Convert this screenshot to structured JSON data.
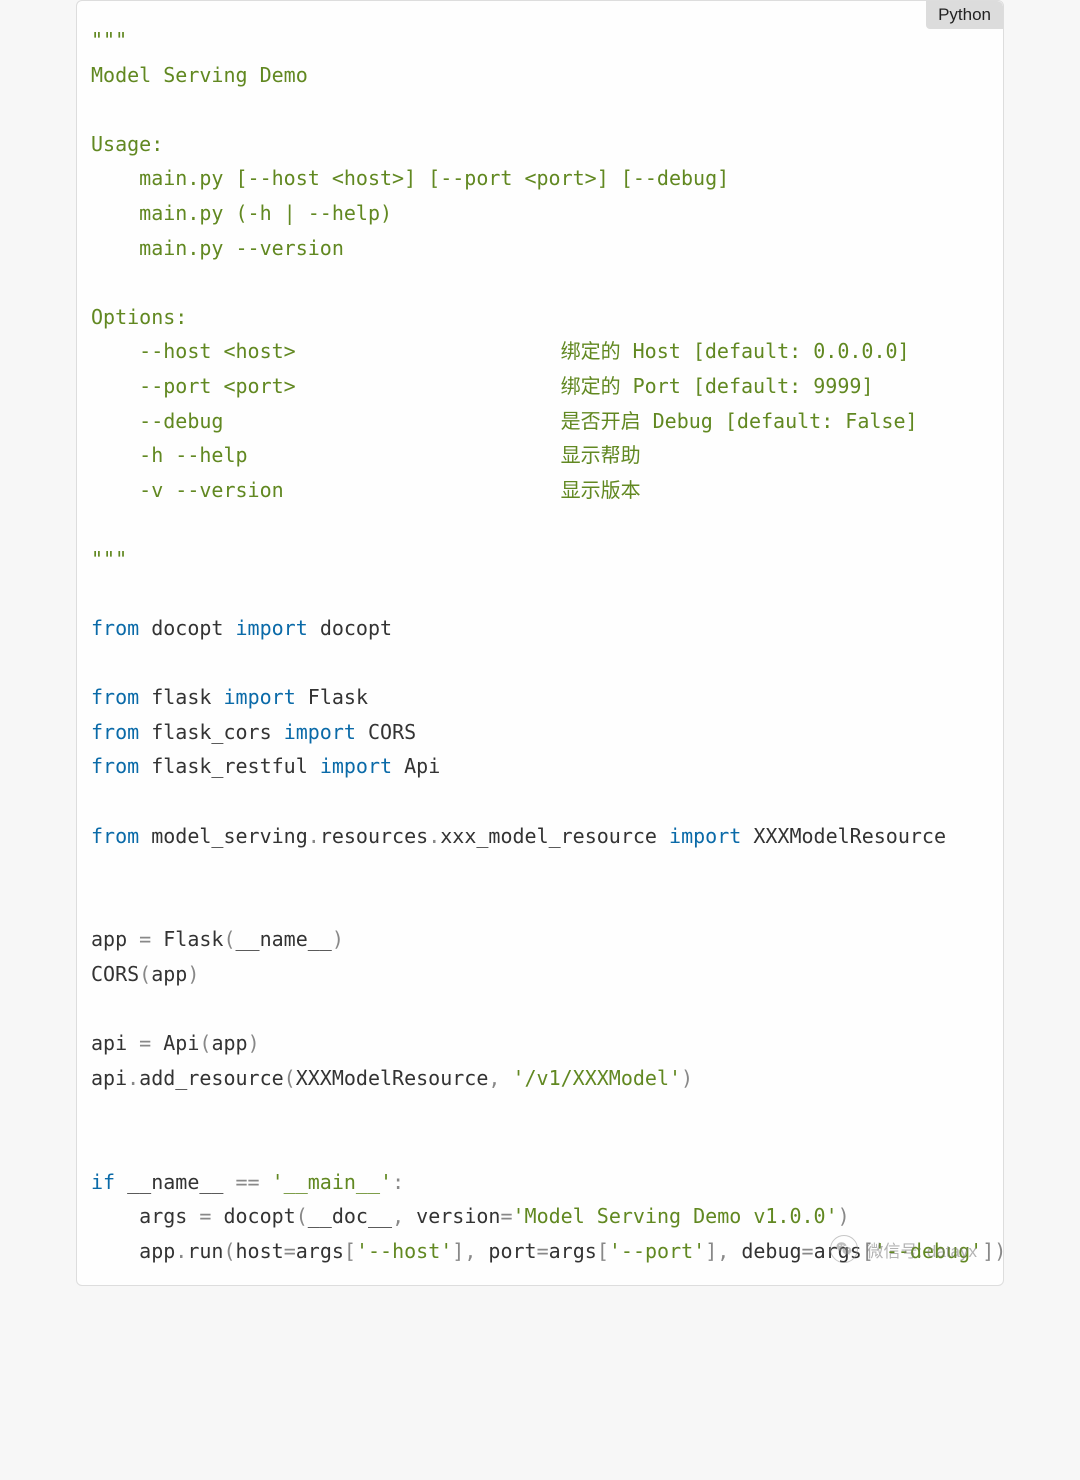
{
  "badge": "Python",
  "watermark_text": "微信号: datayx",
  "code": {
    "docstring": {
      "open": "\"\"\"",
      "title": "Model Serving Demo",
      "usage_header": "Usage:",
      "usage_lines": [
        "    main.py [--host <host>] [--port <port>] [--debug]",
        "    main.py (-h | --help)",
        "    main.py --version"
      ],
      "options_header": "Options:",
      "options_lines": [
        "    --host <host>                      绑定的 Host [default: 0.0.0.0]",
        "    --port <port>                      绑定的 Port [default: 9999]",
        "    --debug                            是否开启 Debug [default: False]",
        "    -h --help                          显示帮助",
        "    -v --version                       显示版本"
      ],
      "close": "\"\"\""
    },
    "kw_from": "from",
    "kw_import": "import",
    "kw_if": "if",
    "imp1_mod": "docopt",
    "imp1_name": "docopt",
    "imp2_mod": "flask",
    "imp2_name": "Flask",
    "imp3_mod": "flask_cors",
    "imp3_name": "CORS",
    "imp4_mod": "flask_restful",
    "imp4_name": "Api",
    "imp5_mod": "model_serving",
    "imp5_sub1": "resources",
    "imp5_sub2": "xxx_model_resource",
    "imp5_name": "XXXModelResource",
    "app_assign_l": "app ",
    "eq": "=",
    "flask_call": " Flask",
    "lpar": "(",
    "rpar": ")",
    "dunder_name": "__name__",
    "cors_call": "CORS",
    "app_id": "app",
    "api_assign_l": "api ",
    "api_call": " Api",
    "api_id": "api",
    "dot": ".",
    "add_resource": "add_resource",
    "xxxres": "XXXModelResource",
    "comma": ", ",
    "route_str": "'/v1/XXXModel'",
    "main_str": "'__main__'",
    "eqeq": " == ",
    "colon": ":",
    "args_id": "    args ",
    "docopt_call": " docopt",
    "dunder_doc": "__doc__",
    "version_kw": "version",
    "version_str": "'Model Serving Demo v1.0.0'",
    "apprun_indent": "    app",
    "run_id": "run",
    "host_kw": "host",
    "args_ref": "args",
    "host_str": "'--host'",
    "port_kw": "port",
    "port_str": "'--port'",
    "debug_kw": "debug",
    "debug_str": "'--debug'",
    "lbrack": "[",
    "rbrack": "]"
  }
}
